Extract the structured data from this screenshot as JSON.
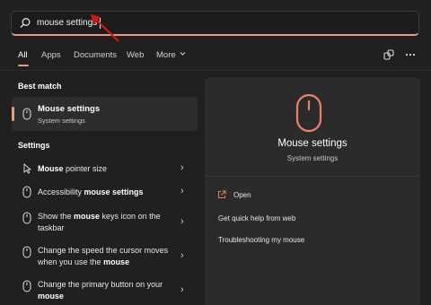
{
  "search": {
    "query": "mouse settings"
  },
  "tabs": [
    {
      "label": "All",
      "active": true
    },
    {
      "label": "Apps"
    },
    {
      "label": "Documents"
    },
    {
      "label": "Web"
    },
    {
      "label": "More"
    }
  ],
  "sections": {
    "best_match": "Best match",
    "settings": "Settings"
  },
  "best_match": {
    "title": "Mouse settings",
    "subtitle": "System settings"
  },
  "settings_results": [
    {
      "prefix": "",
      "bold": "Mouse",
      "suffix": " pointer size"
    },
    {
      "prefix": "Accessibility ",
      "bold": "mouse settings",
      "suffix": ""
    },
    {
      "prefix": "Show the ",
      "bold": "mouse",
      "suffix": " keys icon on the taskbar"
    },
    {
      "prefix": "Change the speed the cursor moves when you use the ",
      "bold": "mouse",
      "suffix": ""
    },
    {
      "prefix": "Change the primary button on your ",
      "bold": "mouse",
      "suffix": ""
    }
  ],
  "preview": {
    "title": "Mouse settings",
    "subtitle": "System settings",
    "open": "Open",
    "help": "Get quick help from web",
    "trouble": "Troubleshooting my mouse"
  },
  "colors": {
    "accent": "#e89a86",
    "arrow": "#d01818",
    "background": "#202020"
  },
  "icons": [
    "search-icon",
    "mouse-icon",
    "chevron-right-icon",
    "open-external-icon",
    "share-icon",
    "more-icon"
  ]
}
